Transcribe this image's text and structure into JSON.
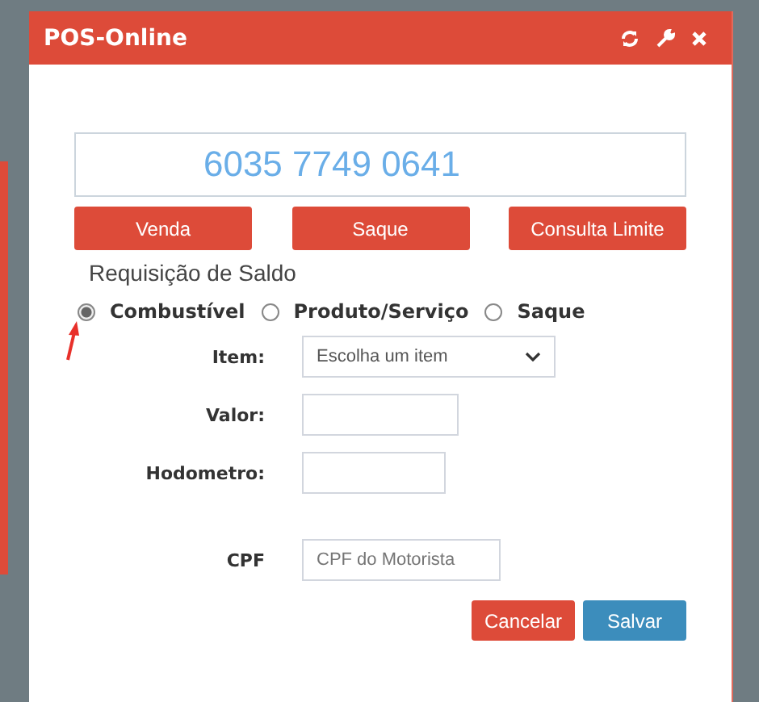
{
  "window": {
    "title": "POS-Online"
  },
  "card_number": "6035 7749 0641",
  "actions": [
    "Venda",
    "Saque",
    "Consulta Limite"
  ],
  "section_title": "Requisição de Saldo",
  "options": [
    {
      "label": "Combustível",
      "selected": true
    },
    {
      "label": "Produto/Serviço",
      "selected": false
    },
    {
      "label": "Saque",
      "selected": false
    }
  ],
  "fields": [
    {
      "kind": "select",
      "label": "Item:",
      "value": "Escolha um item"
    },
    {
      "kind": "text",
      "label": "Valor:"
    },
    {
      "kind": "short",
      "label": "Hodometro:"
    },
    {
      "kind": "wide",
      "label": "CPF",
      "placeholder": "CPF do Motorista"
    }
  ],
  "buttons": [
    {
      "label": "Cancelar",
      "kind": "danger"
    },
    {
      "label": "Salvar",
      "kind": "primary"
    }
  ]
}
